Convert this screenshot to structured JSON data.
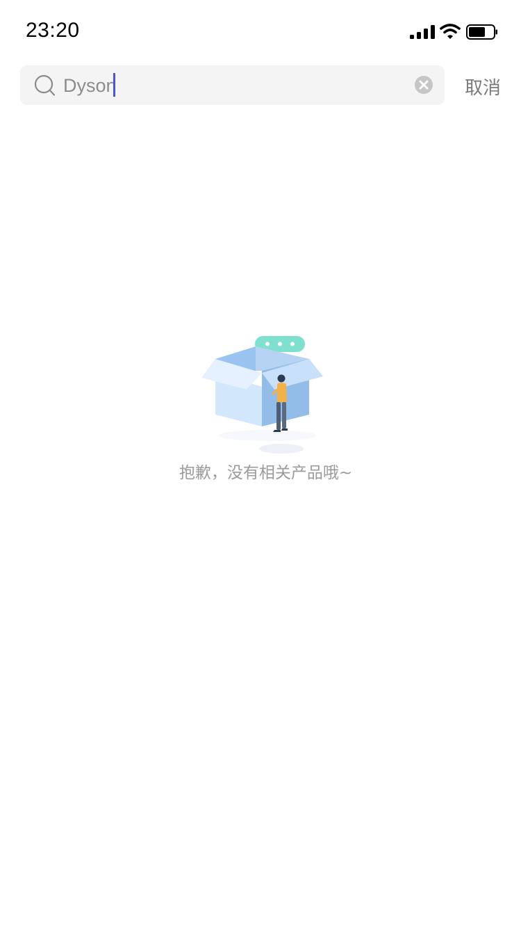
{
  "status_bar": {
    "time": "23:20",
    "signal_icon": "cellular-signal-icon",
    "wifi_icon": "wifi-icon",
    "battery_icon": "battery-icon"
  },
  "search": {
    "value": "Dyson",
    "search_icon": "search-icon",
    "clear_icon": "clear-icon",
    "cancel_label": "取消"
  },
  "empty_state": {
    "illustration_icon": "empty-box-illustration",
    "message": "抱歉，没有相关产品哦~"
  },
  "colors": {
    "caret": "#4b55d6",
    "search_bg": "#f4f4f4",
    "muted_text": "#9b9b9b"
  }
}
